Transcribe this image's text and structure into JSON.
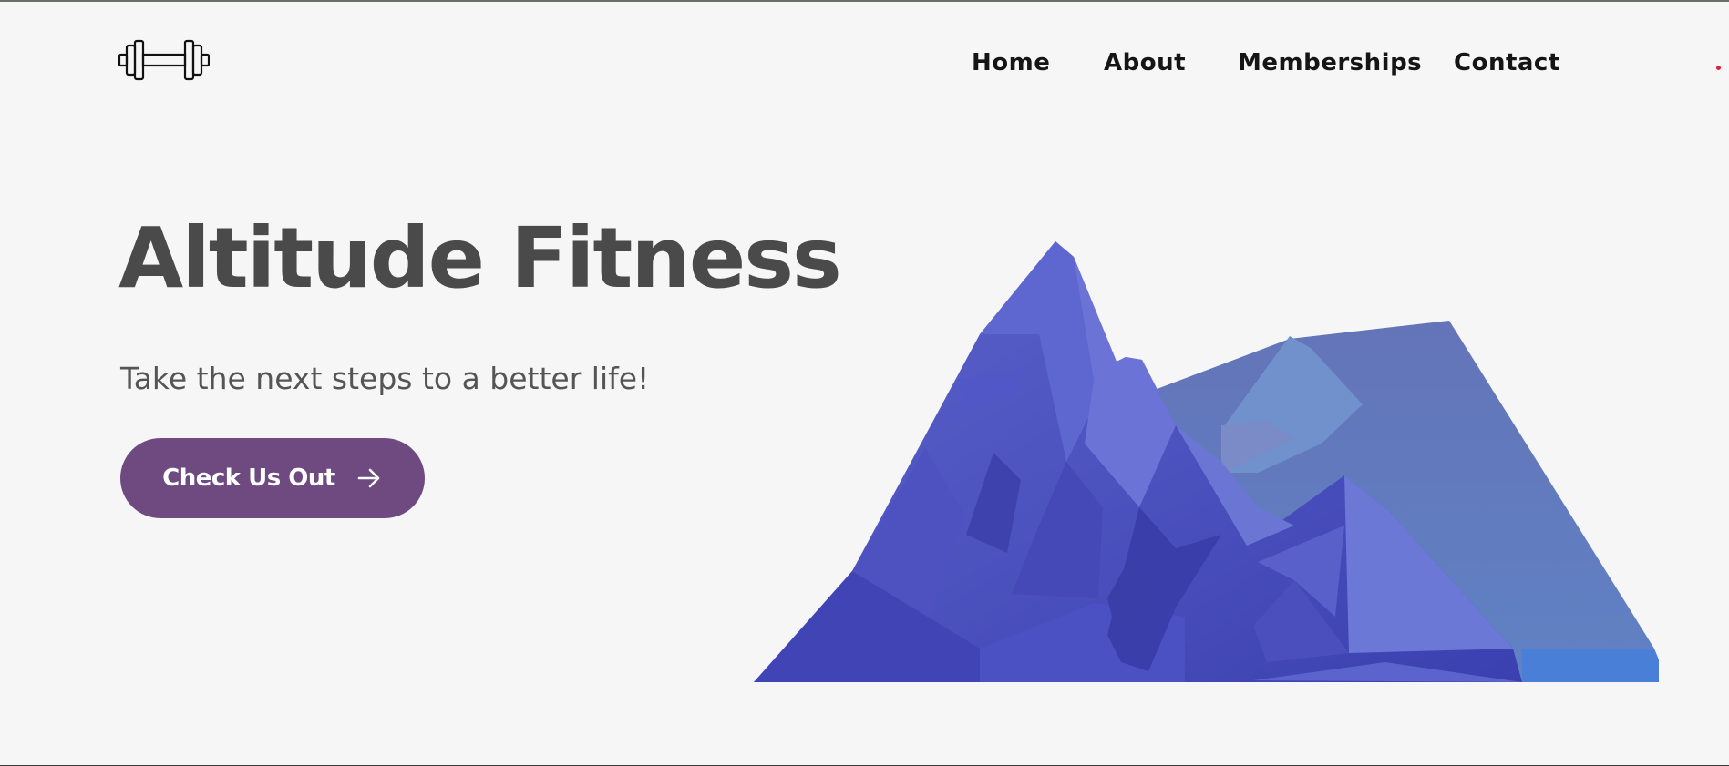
{
  "header": {
    "logo_icon": "dumbbell-icon",
    "nav": [
      "Home",
      "About",
      "Memberships",
      "Contact"
    ]
  },
  "hero": {
    "title": "Altitude Fitness",
    "subtitle": "Take the next steps to a better life!",
    "cta_label": "Check Us Out",
    "cta_icon": "arrow-right-icon",
    "illustration": "mountain-illustration"
  },
  "colors": {
    "background": "#f6f6f6",
    "heading": "#4a4a4a",
    "nav_text": "#151515",
    "cta_bg": "#6e4a80",
    "mountain_front": "#4b4fbf",
    "mountain_back": "#6279bd"
  }
}
